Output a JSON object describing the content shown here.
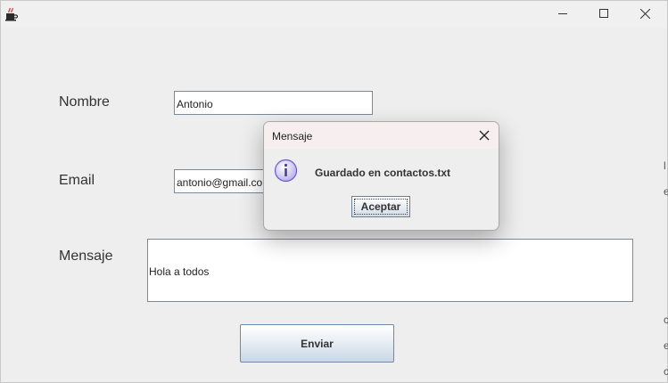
{
  "form": {
    "nombre_label": "Nombre",
    "nombre_value": "Antonio",
    "email_label": "Email",
    "email_value": "antonio@gmail.com",
    "mensaje_label": "Mensaje",
    "mensaje_value": "Hola a todos",
    "send_label": "Enviar"
  },
  "dialog": {
    "title": "Mensaje",
    "message": "Guardado en contactos.txt",
    "ok_label": "Aceptar"
  },
  "background_edge": [
    "l",
    "e",
    "c",
    "e",
    "c"
  ],
  "icons": {
    "app": "java-cup-icon",
    "minimize": "minimize-icon",
    "maximize": "maximize-icon",
    "close": "close-icon",
    "info": "info-icon"
  },
  "colors": {
    "window_bg": "#eeeeee",
    "dialog_title_bg": "#f7efef",
    "info_icon": "#6a5acd"
  }
}
